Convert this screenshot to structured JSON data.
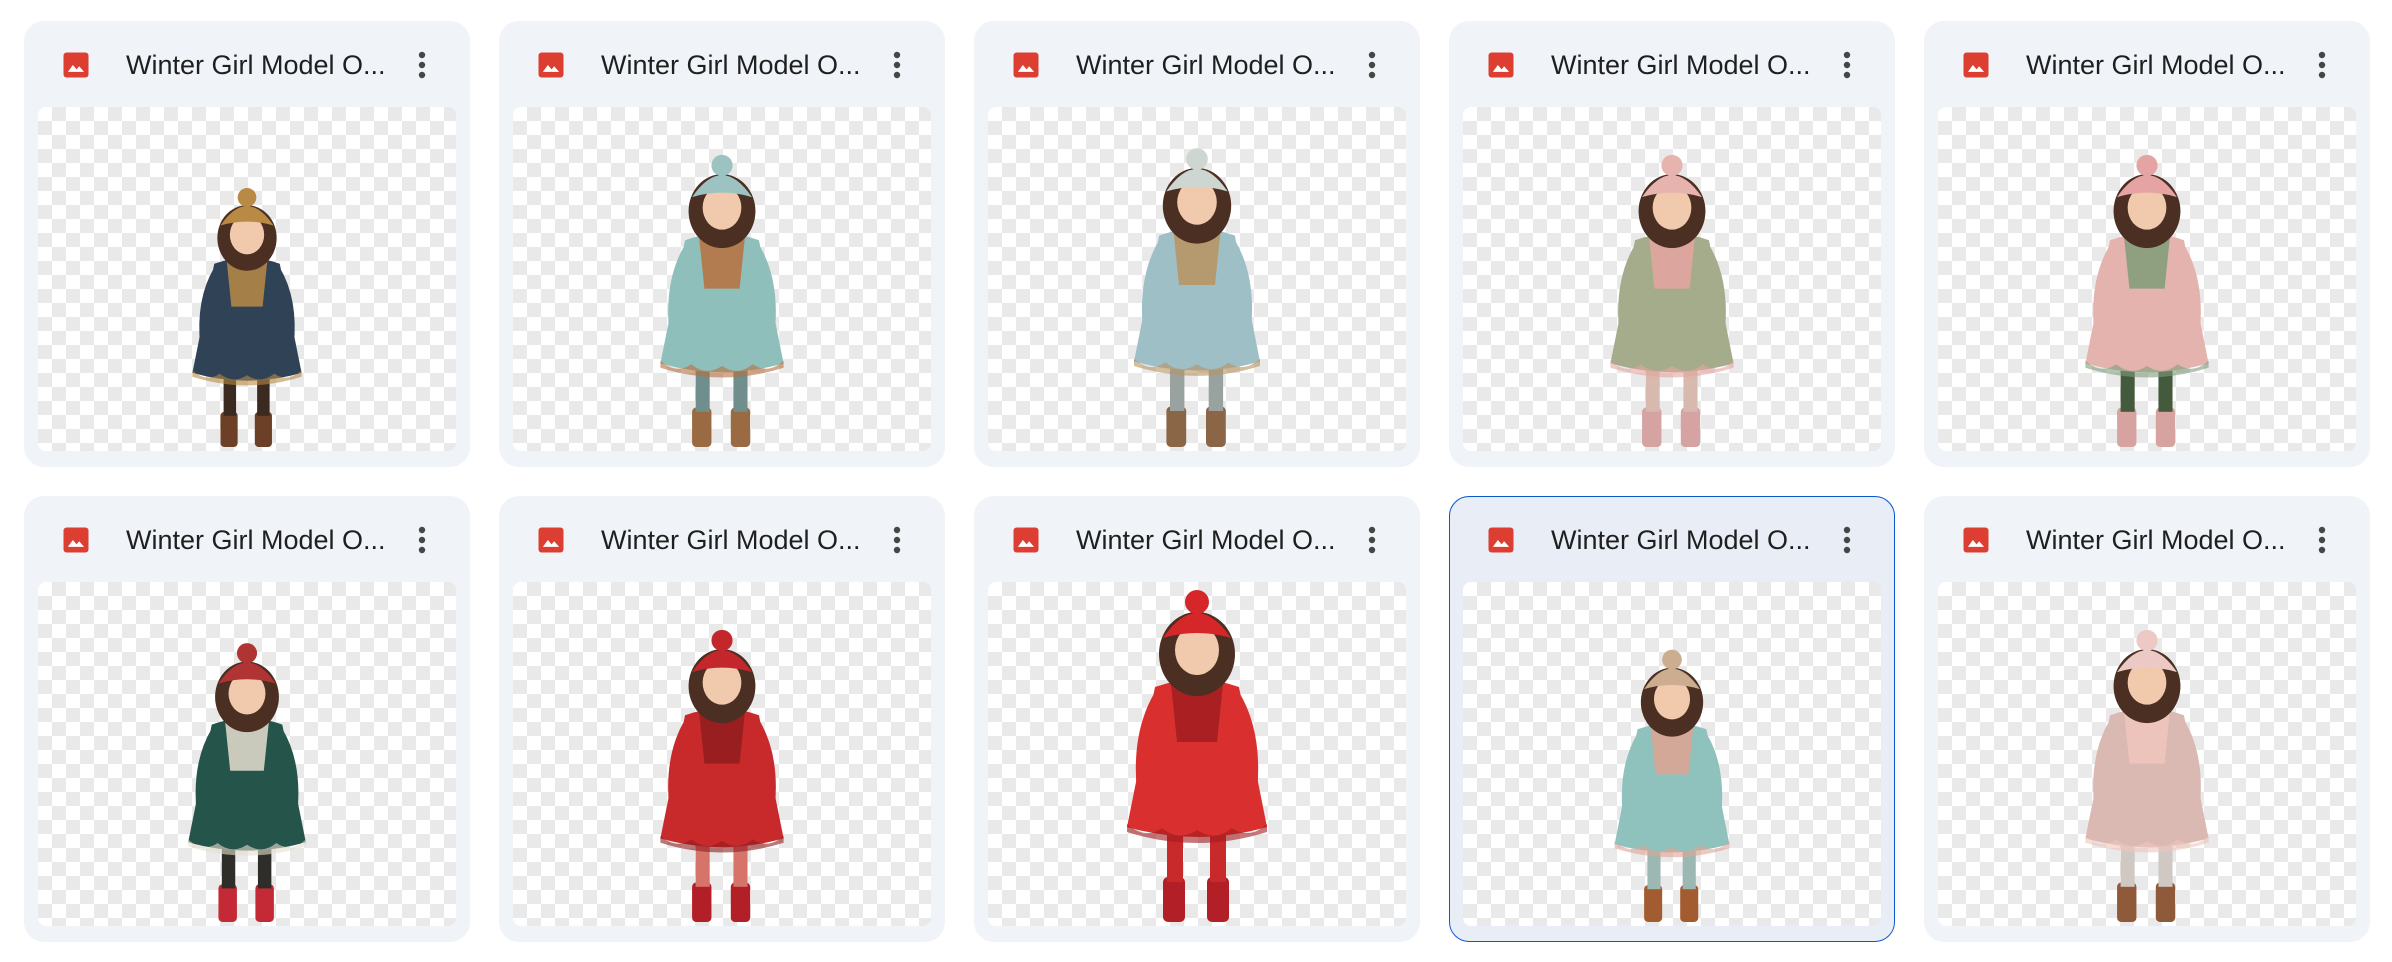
{
  "icons": {
    "file_type": "image-file-icon",
    "menu": "more-vert-icon"
  },
  "colors": {
    "file_icon": "#dc3f31",
    "card_bg": "#f0f4f9",
    "selected_border": "#0b57d0"
  },
  "files": [
    {
      "title": "Winter Girl Model O...",
      "selected": false,
      "hat": "#b98a44",
      "coat": "#2f4256",
      "trim": "#b98a44",
      "legs": "#3b2a20",
      "boots": "#6b4026",
      "scale": 0.78
    },
    {
      "title": "Winter Girl Model O...",
      "selected": false,
      "hat": "#9cc2c1",
      "coat": "#8fbfba",
      "trim": "#b8703d",
      "legs": "#6f8e8c",
      "boots": "#9a6a43",
      "scale": 0.88
    },
    {
      "title": "Winter Girl Model O...",
      "selected": false,
      "hat": "#cdd6d0",
      "coat": "#9fbfc7",
      "trim": "#b8935f",
      "legs": "#9aa2a0",
      "boots": "#8a6646",
      "scale": 0.9
    },
    {
      "title": "Winter Girl Model O...",
      "selected": false,
      "hat": "#e7b3ae",
      "coat": "#a4ac8b",
      "trim": "#e6a5a2",
      "legs": "#d7b9ad",
      "boots": "#d5a3a2",
      "scale": 0.88
    },
    {
      "title": "Winter Girl Model O...",
      "selected": false,
      "hat": "#e6a3a4",
      "coat": "#e4b3ae",
      "trim": "#7f9c78",
      "legs": "#445a3c",
      "boots": "#d7a3a1",
      "scale": 0.88
    },
    {
      "title": "Winter Girl Model O...",
      "selected": false,
      "hat": "#b03434",
      "coat": "#25544a",
      "trim": "#e8dfd0",
      "legs": "#2f2d2a",
      "boots": "#c32a35",
      "scale": 0.84
    },
    {
      "title": "Winter Girl Model O...",
      "selected": false,
      "hat": "#c3272b",
      "coat": "#c82a2c",
      "trim": "#8f1c1f",
      "legs": "#d6746a",
      "boots": "#b21f26",
      "scale": 0.88
    },
    {
      "title": "Winter Girl Model O...",
      "selected": false,
      "hat": "#d5262a",
      "coat": "#d9302f",
      "trim": "#a11c1f",
      "legs": "#c82a2c",
      "boots": "#b21f26",
      "scale": 1.0
    },
    {
      "title": "Winter Girl Model O...",
      "selected": true,
      "hat": "#ccad90",
      "coat": "#8fc2bc",
      "trim": "#e0a392",
      "legs": "#9bb8b3",
      "boots": "#a25c2f",
      "scale": 0.82
    },
    {
      "title": "Winter Girl Model O...",
      "selected": false,
      "hat": "#ecc9c4",
      "coat": "#d9b9b1",
      "trim": "#f0c5bd",
      "legs": "#cfc8c3",
      "boots": "#8f5a3a",
      "scale": 0.88
    }
  ]
}
